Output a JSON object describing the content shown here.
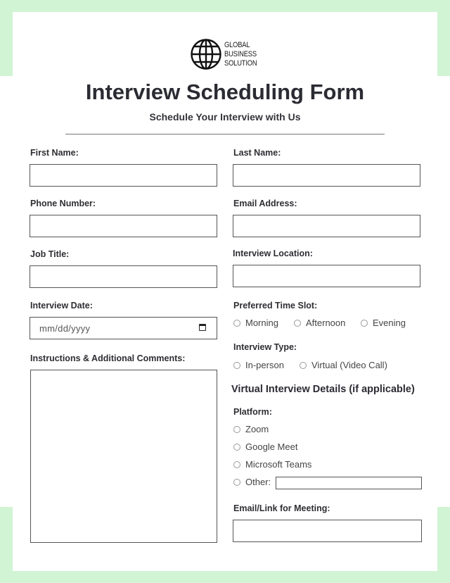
{
  "brand": {
    "logo_icon": "globe-icon",
    "line1": "GLOBAL",
    "line2": "BUSINESS",
    "line3": "SOLUTION"
  },
  "header": {
    "title": "Interview Scheduling Form",
    "subtitle": "Schedule Your Interview with Us"
  },
  "colors": {
    "accent_green": "#d0f4d4",
    "text": "#2b2b33",
    "border": "#555555"
  },
  "fields": {
    "first_name": {
      "label": "First Name:",
      "value": ""
    },
    "last_name": {
      "label": "Last Name:",
      "value": ""
    },
    "phone": {
      "label": "Phone Number:",
      "value": ""
    },
    "email": {
      "label": "Email Address:",
      "value": ""
    },
    "job_title": {
      "label": "Job Title:",
      "value": ""
    },
    "location": {
      "label": "Interview Location:",
      "value": ""
    },
    "date": {
      "label": "Interview Date:",
      "placeholder": "mm/dd/yyyy",
      "icon": "calendar-icon"
    },
    "comments": {
      "label": "Instructions & Additional Comments:",
      "value": ""
    },
    "meeting_link": {
      "label": "Email/Link for Meeting:",
      "value": ""
    }
  },
  "time_slot": {
    "label": "Preferred Time Slot:",
    "options": [
      "Morning",
      "Afternoon",
      "Evening"
    ]
  },
  "interview_type": {
    "label": "Interview Type:",
    "options": [
      "In-person",
      "Virtual (Video Call)"
    ]
  },
  "virtual": {
    "title": "Virtual Interview Details (if applicable)",
    "platform_label": "Platform:",
    "options": [
      "Zoom",
      "Google Meet",
      "Microsoft Teams",
      "Other:"
    ]
  }
}
